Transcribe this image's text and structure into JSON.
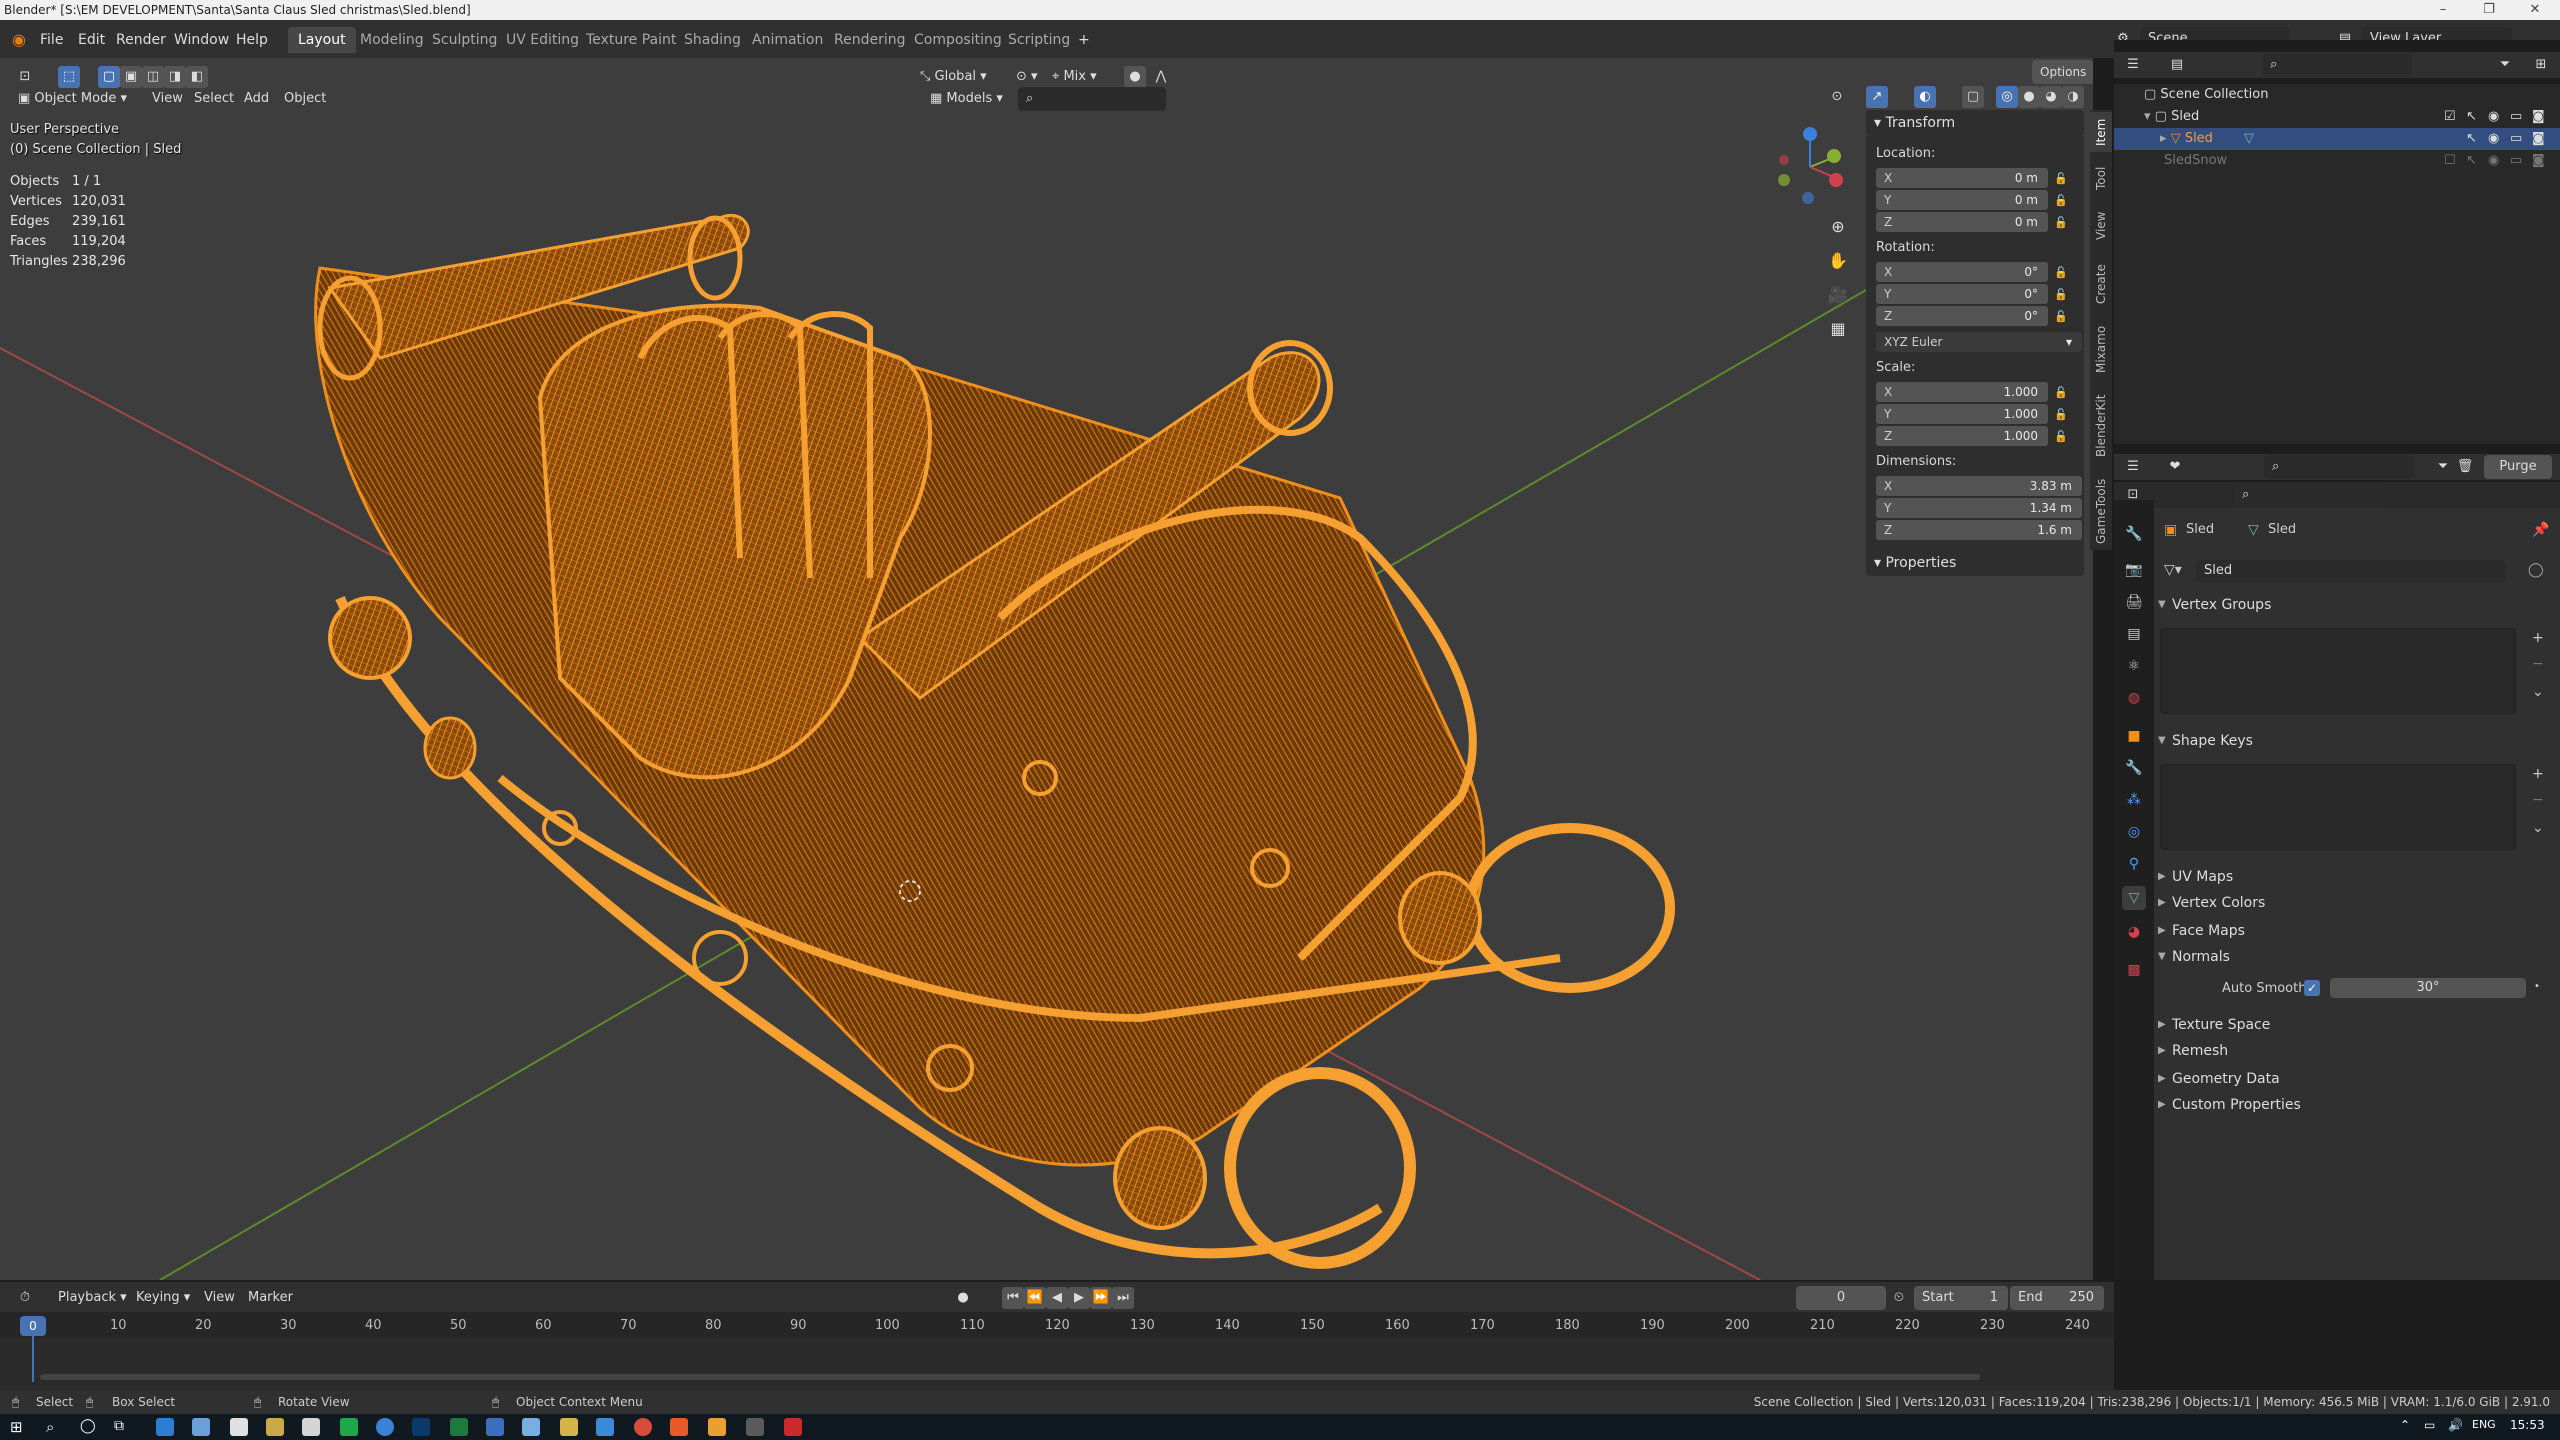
{
  "window": {
    "title": "Blender* [S:\\EM DEVELOPMENT\\Santa\\Santa Claus Sled christmas\\Sled.blend]",
    "minimize_icon": "minimize-icon",
    "maximize_icon": "maximize-icon",
    "close_icon": "close-icon"
  },
  "menu": {
    "file": "File",
    "edit": "Edit",
    "render": "Render",
    "window": "Window",
    "help": "Help"
  },
  "workspaces": [
    "Layout",
    "Modeling",
    "Sculpting",
    "UV Editing",
    "Texture Paint",
    "Shading",
    "Animation",
    "Rendering",
    "Compositing",
    "Scripting"
  ],
  "active_workspace": "Layout",
  "scene": {
    "name": "Scene",
    "view_layer": "View Layer"
  },
  "viewport_header": {
    "mode": "Object Mode",
    "view": "View",
    "select": "Select",
    "add": "Add",
    "object": "Object",
    "orientation": "Global",
    "snap_mode": "Mix",
    "collection": "Models",
    "options": "Options"
  },
  "viewport_overlay": {
    "perspective": "User Perspective",
    "collection_path": "(0) Scene Collection | Sled",
    "stats": [
      {
        "label": "Objects",
        "value": "1 / 1"
      },
      {
        "label": "Vertices",
        "value": "120,031"
      },
      {
        "label": "Edges",
        "value": "239,161"
      },
      {
        "label": "Faces",
        "value": "119,204"
      },
      {
        "label": "Triangles",
        "value": "238,296"
      }
    ],
    "wire_color": "#f0901a",
    "grid_x_color": "#b04040",
    "grid_y_color": "#6a9a2a"
  },
  "npanel": {
    "transform": "Transform",
    "location_label": "Location:",
    "location": [
      {
        "axis": "X",
        "value": "0 m"
      },
      {
        "axis": "Y",
        "value": "0 m"
      },
      {
        "axis": "Z",
        "value": "0 m"
      }
    ],
    "rotation_label": "Rotation:",
    "rotation": [
      {
        "axis": "X",
        "value": "0°"
      },
      {
        "axis": "Y",
        "value": "0°"
      },
      {
        "axis": "Z",
        "value": "0°"
      }
    ],
    "rotation_mode": "XYZ Euler",
    "scale_label": "Scale:",
    "scale": [
      {
        "axis": "X",
        "value": "1.000"
      },
      {
        "axis": "Y",
        "value": "1.000"
      },
      {
        "axis": "Z",
        "value": "1.000"
      }
    ],
    "dimensions_label": "Dimensions:",
    "dimensions": [
      {
        "axis": "X",
        "value": "3.83 m"
      },
      {
        "axis": "Y",
        "value": "1.34 m"
      },
      {
        "axis": "Z",
        "value": "1.6 m"
      }
    ],
    "properties": "Properties",
    "tabs": [
      "Item",
      "Tool",
      "View",
      "Create",
      "Mixamo",
      "BlenderKit",
      "GameTools"
    ]
  },
  "outliner": {
    "root": "Scene Collection",
    "items": [
      {
        "name": "Sled",
        "type": "collection"
      },
      {
        "name": "Sled",
        "type": "object",
        "selected": true
      },
      {
        "name": "SledSnow",
        "type": "object"
      }
    ],
    "purge": "Purge"
  },
  "properties": {
    "object_name": "Sled",
    "data_name": "Sled",
    "mesh_name": "Sled",
    "sections": [
      {
        "label": "Vertex Groups",
        "open": true
      },
      {
        "label": "Shape Keys",
        "open": true
      },
      {
        "label": "UV Maps",
        "open": false
      },
      {
        "label": "Vertex Colors",
        "open": false
      },
      {
        "label": "Face Maps",
        "open": false
      },
      {
        "label": "Normals",
        "open": true
      },
      {
        "label": "Texture Space",
        "open": false
      },
      {
        "label": "Remesh",
        "open": false
      },
      {
        "label": "Geometry Data",
        "open": false
      },
      {
        "label": "Custom Properties",
        "open": false
      }
    ],
    "auto_smooth_label": "Auto Smooth",
    "auto_smooth_angle": "30°"
  },
  "timeline": {
    "playback": "Playback",
    "keying": "Keying",
    "view": "View",
    "marker": "Marker",
    "current_frame": "0",
    "start_label": "Start",
    "start": "1",
    "end_label": "End",
    "end": "250",
    "ticks": [
      "10",
      "20",
      "30",
      "40",
      "50",
      "60",
      "70",
      "80",
      "90",
      "100",
      "110",
      "120",
      "130",
      "140",
      "150",
      "160",
      "170",
      "180",
      "190",
      "200",
      "210",
      "220",
      "230",
      "240"
    ],
    "playhead": "0"
  },
  "statusbar": {
    "select": "Select",
    "box_select": "Box Select",
    "rotate_view": "Rotate View",
    "context_menu": "Object Context Menu",
    "info": "Scene Collection | Sled | Verts:120,031 | Faces:119,204 | Tris:238,296 | Objects:1/1 | Memory: 456.5 MiB | VRAM: 1.1/6.0 GiB | 2.91.0"
  },
  "taskbar": {
    "time": "15:53"
  }
}
